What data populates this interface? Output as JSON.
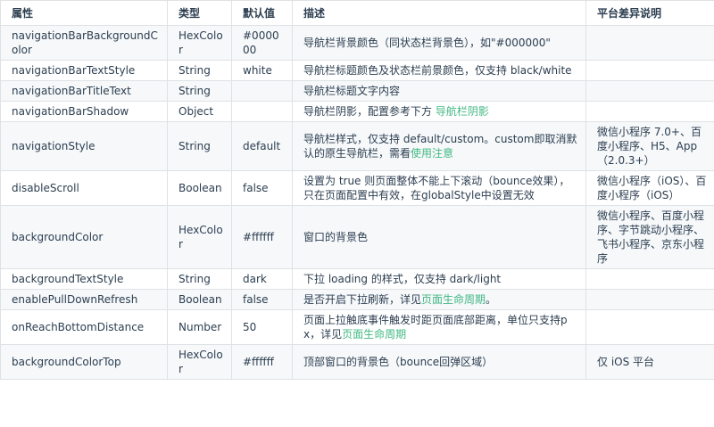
{
  "table": {
    "headers": [
      "属性",
      "类型",
      "默认值",
      "描述",
      "平台差异说明"
    ],
    "rows": [
      {
        "name": "navigationBarBackgroundColor",
        "type": "HexColor",
        "default": "#000000",
        "desc": "导航栏背景颜色（同状态栏背景色），如\"#000000\"",
        "link": "",
        "desc_after": "",
        "platform": ""
      },
      {
        "name": "navigationBarTextStyle",
        "type": "String",
        "default": "white",
        "desc": "导航栏标题颜色及状态栏前景颜色，仅支持 black/white",
        "link": "",
        "desc_after": "",
        "platform": ""
      },
      {
        "name": "navigationBarTitleText",
        "type": "String",
        "default": "",
        "desc": "导航栏标题文字内容",
        "link": "",
        "desc_after": "",
        "platform": ""
      },
      {
        "name": "navigationBarShadow",
        "type": "Object",
        "default": "",
        "desc": "导航栏阴影，配置参考下方 ",
        "link": "导航栏阴影",
        "desc_after": "",
        "platform": ""
      },
      {
        "name": "navigationStyle",
        "type": "String",
        "default": "default",
        "desc": "导航栏样式，仅支持 default/custom。custom即取消默认的原生导航栏，需看",
        "link": "使用注意",
        "desc_after": "",
        "platform": "微信小程序 7.0+、百度小程序、H5、App（2.0.3+）"
      },
      {
        "name": "disableScroll",
        "type": "Boolean",
        "default": "false",
        "desc": "设置为 true 则页面整体不能上下滚动（bounce效果），只在页面配置中有效，在globalStyle中设置无效",
        "link": "",
        "desc_after": "",
        "platform": "微信小程序（iOS）、百度小程序（iOS）"
      },
      {
        "name": "backgroundColor",
        "type": "HexColor",
        "default": "#ffffff",
        "desc": "窗口的背景色",
        "link": "",
        "desc_after": "",
        "platform": "微信小程序、百度小程序、字节跳动小程序、飞书小程序、京东小程序"
      },
      {
        "name": "backgroundTextStyle",
        "type": "String",
        "default": "dark",
        "desc": "下拉 loading 的样式，仅支持 dark/light",
        "link": "",
        "desc_after": "",
        "platform": ""
      },
      {
        "name": "enablePullDownRefresh",
        "type": "Boolean",
        "default": "false",
        "desc": "是否开启下拉刷新，详见",
        "link": "页面生命周期",
        "desc_after": "。",
        "platform": ""
      },
      {
        "name": "onReachBottomDistance",
        "type": "Number",
        "default": "50",
        "desc": "页面上拉触底事件触发时距页面底部距离，单位只支持px，详见",
        "link": "页面生命周期",
        "desc_after": "",
        "platform": ""
      },
      {
        "name": "backgroundColorTop",
        "type": "HexColor",
        "default": "#ffffff",
        "desc": "顶部窗口的背景色（bounce回弹区域）",
        "link": "",
        "desc_after": "",
        "platform": "仅 iOS 平台"
      }
    ]
  },
  "colors": {
    "link": "#42b983",
    "text": "#2c3e50",
    "border": "#dfe2e5",
    "stripe": "#f6f8fa"
  }
}
